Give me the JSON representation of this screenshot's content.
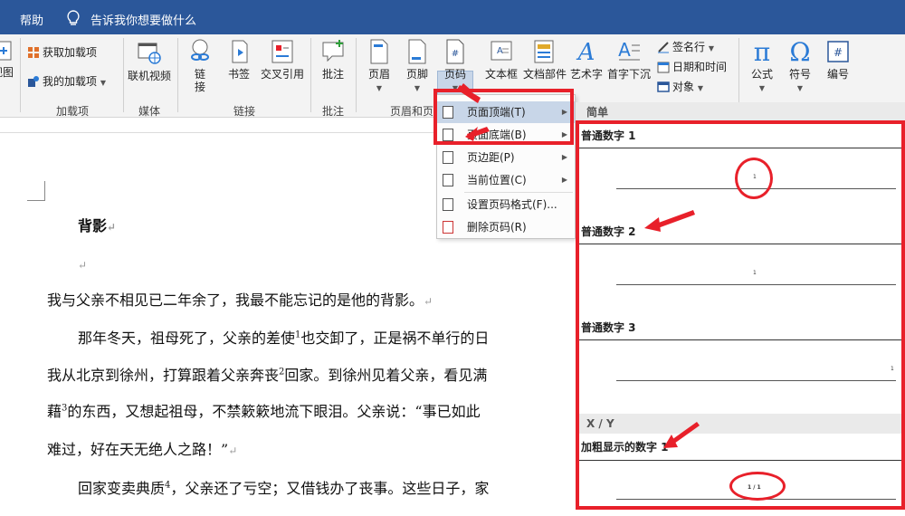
{
  "titlebar": {
    "help": "帮助",
    "tell_me": "告诉我你想要做什么"
  },
  "ribbon": {
    "groups": {
      "addins": "加载项",
      "media": "媒体",
      "links": "链接",
      "comments": "批注",
      "header_footer": "页眉和页"
    },
    "buttons": {
      "cut_view": "视图",
      "get_addins": "获取加载项",
      "my_addins": "我的加载项",
      "online_video": "联机视频",
      "link": "链\n接",
      "bookmark": "书签",
      "cross_ref": "交叉引用",
      "comment": "批注",
      "header": "页眉",
      "footer": "页脚",
      "page_number": "页码",
      "textbox": "文本框",
      "quick_parts": "文档部件",
      "wordart": "艺术字",
      "dropcap": "首字下沉",
      "signature": "签名行",
      "datetime": "日期和时间",
      "object": "对象",
      "equation": "公式",
      "symbol": "符号",
      "number": "编号"
    }
  },
  "menu": {
    "items": [
      {
        "label": "页面顶端(T)",
        "has_submenu": true,
        "active": true
      },
      {
        "label": "页面底端(B)",
        "has_submenu": true,
        "active": false
      },
      {
        "label": "页边距(P)",
        "has_submenu": true,
        "active": false
      },
      {
        "label": "当前位置(C)",
        "has_submenu": true,
        "active": false
      },
      {
        "label": "设置页码格式(F)...",
        "has_submenu": false,
        "active": false
      },
      {
        "label": "删除页码(R)",
        "has_submenu": false,
        "active": false
      }
    ]
  },
  "gallery": {
    "section_simple": "简单",
    "item1": "普通数字 1",
    "item2": "普通数字 2",
    "item3": "普通数字 3",
    "section_xy": "X / Y",
    "item4": "加粗显示的数字 1",
    "num1": "1",
    "num2": "1",
    "num3": "1",
    "num4": "1 / 1"
  },
  "document": {
    "heading": "背影",
    "return_mark": "↵",
    "p1": "我与父亲不相见已二年余了，我最不能忘记的是他的背影。",
    "p2a": "那年冬天，祖母死了，父亲的差使",
    "p2a_sup": "1",
    "p2a_end": "也交卸了，正是祸不单行的日",
    "p2b": "我从北京到徐州，打算跟着父亲奔丧",
    "p2b_sup": "2",
    "p2b_end": "回家。到徐州见着父亲，看见满",
    "p2c": "藉",
    "p2c_sup": "3",
    "p2c_end": "的东西，又想起祖母，不禁簌簌地流下眼泪。父亲说：“事已如此",
    "p2d": "难过，好在天无绝人之路！”",
    "p3": "回家变卖典质",
    "p3_sup": "4",
    "p3_end": "，父亲还了亏空；又借钱办了丧事。这些日子，家"
  },
  "annotation_color": "#e8202a",
  "accent_color": "#2b579a"
}
